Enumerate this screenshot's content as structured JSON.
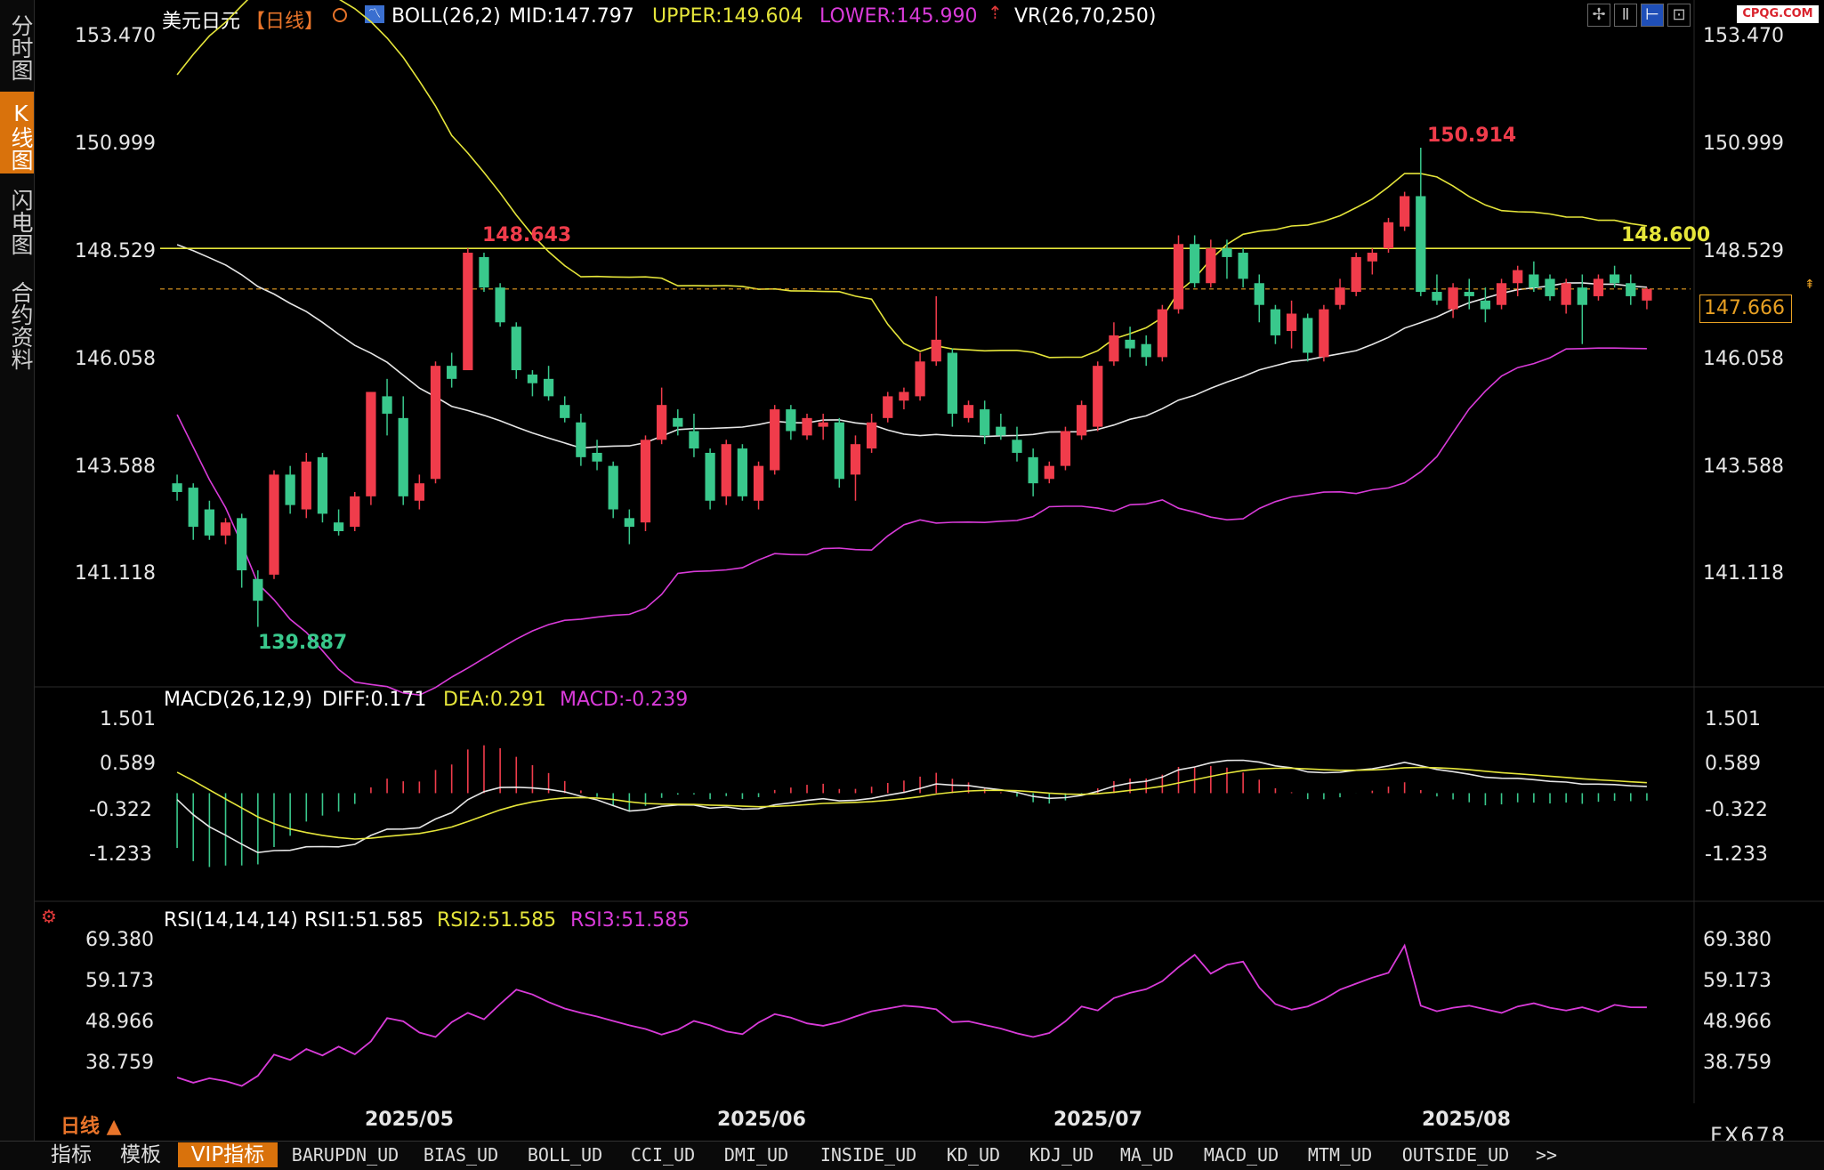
{
  "left_tabs": [
    {
      "label": "分时图",
      "active": false
    },
    {
      "label": "K线图",
      "active": true
    },
    {
      "label": "闪电图",
      "active": false
    },
    {
      "label": "合约资料",
      "active": false
    }
  ],
  "header": {
    "symbol": "美元日元",
    "period": "【日线】",
    "boll": "BOLL(26,2)",
    "mid": "MID:147.797",
    "upper": "UPPER:149.604",
    "lower": "LOWER:145.990",
    "vr": "VR(26,70,250)",
    "watermark": "CPQG.COM"
  },
  "colors": {
    "up": "#f03c4b",
    "down": "#39c88c",
    "upper_band": "#e5e53a",
    "lower_band": "#d93bd9",
    "mid_band": "#e6e6e6",
    "hline": "#e5e53a",
    "price_line": "#e8a023",
    "accent": "#d9720c"
  },
  "main_chart": {
    "y_ticks": [
      "153.470",
      "150.999",
      "148.529",
      "146.058",
      "143.588",
      "141.118"
    ],
    "y_values": [
      153.47,
      150.999,
      148.529,
      146.058,
      143.588,
      141.118
    ],
    "hline_value": 148.6,
    "hline_label": "148.600",
    "last_price": 147.666,
    "last_price_label": "147.666",
    "high_label": "150.914",
    "mid_high_label": "148.643",
    "low_label": "139.887"
  },
  "macd": {
    "title": "MACD(26,12,9)",
    "diff": "DIFF:0.171",
    "dea": "DEA:0.291",
    "macd": "MACD:-0.239",
    "y_ticks": [
      "1.501",
      "0.589",
      "-0.322",
      "-1.233"
    ],
    "y_values": [
      1.501,
      0.589,
      -0.322,
      -1.233
    ]
  },
  "rsi": {
    "title": "RSI(14,14,14)",
    "rsi1": "RSI1:51.585",
    "rsi2": "RSI2:51.585",
    "rsi3": "RSI3:51.585",
    "y_ticks": [
      "69.380",
      "59.173",
      "48.966",
      "38.759"
    ],
    "y_values": [
      69.38,
      59.173,
      48.966,
      38.759
    ]
  },
  "x_axis": [
    "2025/05",
    "2025/06",
    "2025/07",
    "2025/08"
  ],
  "period_label": "日线 ▲",
  "brand": "FX678",
  "bottom_tabs": [
    "指标",
    "模板",
    "VIP指标",
    "BARUPDN_UD",
    "BIAS_UD",
    "BOLL_UD",
    "CCI_UD",
    "DMI_UD",
    "INSIDE_UD",
    "KD_UD",
    "KDJ_UD",
    "MA_UD",
    "MACD_UD",
    "MTM_UD",
    "OUTSIDE_UD",
    ">>"
  ],
  "chart_data": [
    {
      "type": "candlestick",
      "title": "美元日元 【日线】 BOLL(26,2)",
      "ylim": [
        139.0,
        154.0
      ],
      "series": [
        {
          "name": "MID",
          "values": [
            147.797
          ]
        },
        {
          "name": "UPPER",
          "values": [
            149.604
          ]
        },
        {
          "name": "LOWER",
          "values": [
            145.99
          ]
        }
      ],
      "annotations": [
        "150.914",
        "148.643",
        "139.887",
        "148.600",
        "147.666"
      ],
      "candles_ohlc": [
        [
          143.2,
          143.4,
          142.8,
          143.0
        ],
        [
          143.1,
          143.2,
          141.9,
          142.2
        ],
        [
          142.6,
          142.8,
          141.9,
          142.0
        ],
        [
          142.0,
          142.4,
          141.8,
          142.3
        ],
        [
          142.4,
          142.5,
          140.8,
          141.2
        ],
        [
          141.0,
          141.2,
          139.9,
          140.5
        ],
        [
          141.1,
          143.5,
          141.0,
          143.4
        ],
        [
          143.4,
          143.6,
          142.5,
          142.7
        ],
        [
          142.6,
          143.9,
          142.4,
          143.7
        ],
        [
          143.8,
          143.9,
          142.3,
          142.5
        ],
        [
          142.3,
          142.6,
          142.0,
          142.1
        ],
        [
          142.2,
          143.0,
          142.1,
          142.9
        ],
        [
          142.9,
          145.3,
          142.7,
          145.3
        ],
        [
          145.2,
          145.6,
          144.3,
          144.8
        ],
        [
          144.7,
          145.2,
          142.7,
          142.9
        ],
        [
          142.8,
          143.4,
          142.6,
          143.2
        ],
        [
          143.3,
          146.0,
          143.2,
          145.9
        ],
        [
          145.9,
          146.2,
          145.4,
          145.6
        ],
        [
          145.8,
          148.6,
          145.8,
          148.5
        ],
        [
          148.4,
          148.5,
          147.6,
          147.7
        ],
        [
          147.7,
          147.8,
          146.8,
          146.9
        ],
        [
          146.8,
          146.9,
          145.6,
          145.8
        ],
        [
          145.7,
          145.8,
          145.2,
          145.5
        ],
        [
          145.6,
          145.9,
          145.1,
          145.2
        ],
        [
          145.0,
          145.2,
          144.6,
          144.7
        ],
        [
          144.6,
          144.8,
          143.6,
          143.8
        ],
        [
          143.9,
          144.2,
          143.5,
          143.7
        ],
        [
          143.6,
          143.7,
          142.4,
          142.6
        ],
        [
          142.4,
          142.6,
          141.8,
          142.2
        ],
        [
          142.3,
          144.3,
          142.1,
          144.2
        ],
        [
          144.2,
          145.4,
          144.1,
          145.0
        ],
        [
          144.7,
          144.9,
          144.3,
          144.5
        ],
        [
          144.4,
          144.8,
          143.8,
          144.0
        ],
        [
          143.9,
          144.0,
          142.6,
          142.8
        ],
        [
          142.9,
          144.2,
          142.7,
          144.1
        ],
        [
          144.0,
          144.1,
          142.8,
          142.9
        ],
        [
          142.8,
          143.7,
          142.6,
          143.6
        ],
        [
          143.5,
          145.0,
          143.4,
          144.9
        ],
        [
          144.9,
          145.0,
          144.2,
          144.4
        ],
        [
          144.3,
          144.8,
          144.2,
          144.7
        ],
        [
          144.5,
          144.8,
          144.2,
          144.6
        ],
        [
          144.6,
          144.7,
          143.1,
          143.3
        ],
        [
          143.4,
          144.3,
          142.8,
          144.1
        ],
        [
          144.0,
          144.8,
          143.9,
          144.6
        ],
        [
          144.7,
          145.3,
          144.6,
          145.2
        ],
        [
          145.1,
          145.4,
          144.9,
          145.3
        ],
        [
          145.2,
          146.2,
          145.1,
          146.0
        ],
        [
          146.0,
          147.5,
          145.9,
          146.5
        ],
        [
          146.2,
          146.3,
          144.5,
          144.8
        ],
        [
          144.7,
          145.1,
          144.6,
          145.0
        ],
        [
          144.9,
          145.1,
          144.1,
          144.3
        ],
        [
          144.5,
          144.8,
          144.2,
          144.3
        ],
        [
          144.2,
          144.5,
          143.7,
          143.9
        ],
        [
          143.8,
          144.0,
          142.9,
          143.2
        ],
        [
          143.3,
          143.7,
          143.2,
          143.6
        ],
        [
          143.6,
          144.5,
          143.5,
          144.4
        ],
        [
          144.3,
          145.1,
          144.2,
          145.0
        ],
        [
          144.5,
          146.0,
          144.4,
          145.9
        ],
        [
          146.0,
          146.9,
          145.9,
          146.6
        ],
        [
          146.5,
          146.8,
          146.1,
          146.3
        ],
        [
          146.4,
          146.6,
          145.9,
          146.1
        ],
        [
          146.1,
          147.3,
          146.0,
          147.2
        ],
        [
          147.2,
          148.9,
          147.1,
          148.7
        ],
        [
          148.7,
          148.9,
          147.7,
          147.8
        ],
        [
          147.8,
          148.8,
          147.7,
          148.6
        ],
        [
          148.6,
          148.8,
          147.9,
          148.4
        ],
        [
          148.5,
          148.6,
          147.7,
          147.9
        ],
        [
          147.8,
          148.0,
          146.9,
          147.3
        ],
        [
          147.2,
          147.3,
          146.4,
          146.6
        ],
        [
          146.7,
          147.4,
          146.3,
          147.1
        ],
        [
          147.0,
          147.1,
          146.0,
          146.2
        ],
        [
          146.1,
          147.3,
          146.0,
          147.2
        ],
        [
          147.3,
          147.9,
          147.2,
          147.7
        ],
        [
          147.6,
          148.5,
          147.5,
          148.4
        ],
        [
          148.3,
          148.6,
          148.0,
          148.5
        ],
        [
          148.6,
          149.3,
          148.5,
          149.2
        ],
        [
          149.1,
          149.9,
          149.0,
          149.8
        ],
        [
          149.8,
          150.914,
          147.5,
          147.6
        ],
        [
          147.6,
          148.0,
          147.3,
          147.4
        ],
        [
          147.2,
          147.8,
          147.0,
          147.7
        ],
        [
          147.6,
          147.9,
          147.2,
          147.5
        ],
        [
          147.4,
          147.7,
          146.9,
          147.2
        ],
        [
          147.3,
          147.9,
          147.2,
          147.8
        ],
        [
          147.8,
          148.2,
          147.5,
          148.1
        ],
        [
          148.0,
          148.3,
          147.6,
          147.7
        ],
        [
          147.9,
          148.0,
          147.4,
          147.5
        ],
        [
          147.3,
          147.9,
          147.1,
          147.8
        ],
        [
          147.7,
          148.0,
          146.4,
          147.3
        ],
        [
          147.5,
          148.0,
          147.4,
          147.9
        ],
        [
          148.0,
          148.2,
          147.7,
          147.8
        ],
        [
          147.8,
          148.0,
          147.3,
          147.5
        ],
        [
          147.4,
          147.7,
          147.2,
          147.666
        ]
      ]
    },
    {
      "type": "bar",
      "title": "MACD(26,12,9)",
      "ylim": [
        -1.8,
        1.9
      ],
      "series": [
        {
          "name": "DIFF",
          "values": [
            0.171
          ]
        },
        {
          "name": "DEA",
          "values": [
            0.291
          ]
        },
        {
          "name": "MACD",
          "values": [
            -0.239
          ]
        }
      ]
    },
    {
      "type": "line",
      "title": "RSI(14,14,14)",
      "ylim": [
        28,
        72
      ],
      "series": [
        {
          "name": "RSI1",
          "values": [
            34.1,
            32.8,
            33.9,
            33.2,
            32.0,
            34.5,
            39.8,
            38.5,
            41.2,
            39.6,
            41.8,
            39.9,
            43.1,
            48.9,
            48.1,
            45.3,
            44.2,
            47.9,
            50.2,
            48.6,
            52.4,
            56.0,
            54.8,
            52.9,
            51.3,
            50.2,
            49.3,
            48.2,
            47.1,
            46.2,
            44.8,
            46.0,
            48.2,
            47.1,
            45.6,
            44.9,
            47.8,
            49.9,
            49.0,
            47.6,
            47.0,
            47.9,
            49.3,
            50.6,
            51.3,
            52.0,
            51.7,
            51.1,
            47.9,
            48.1,
            47.2,
            46.3,
            45.1,
            44.2,
            45.2,
            48.1,
            51.8,
            50.8,
            53.9,
            55.2,
            56.1,
            58.1,
            61.6,
            64.7,
            60.0,
            62.2,
            63.0,
            56.5,
            52.4,
            51.0,
            51.8,
            53.6,
            56.0,
            57.5,
            59.0,
            60.2,
            67.0,
            52.0,
            50.6,
            51.5,
            52.0,
            51.1,
            50.2,
            51.8,
            52.6,
            51.5,
            50.8,
            51.6,
            50.5,
            52.2,
            51.6,
            51.585
          ]
        }
      ]
    }
  ]
}
